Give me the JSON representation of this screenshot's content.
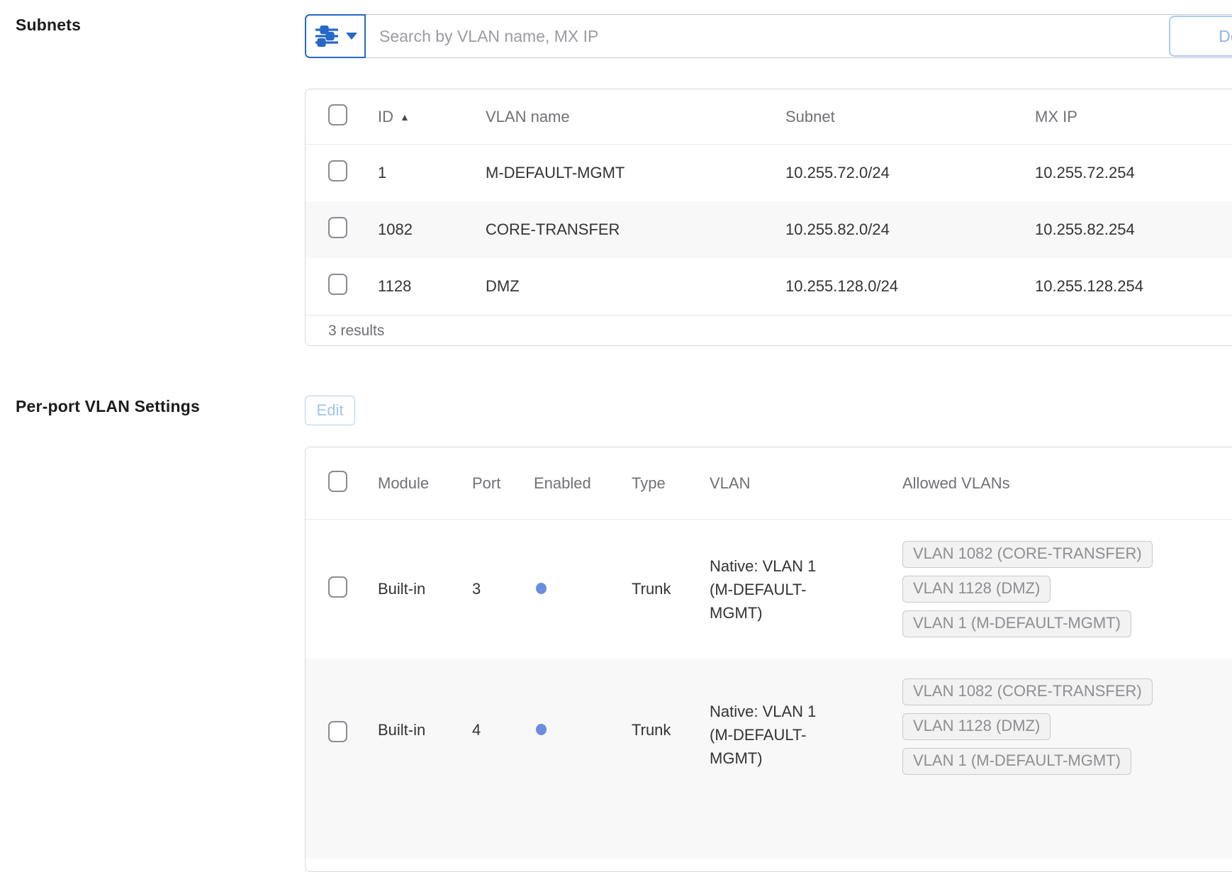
{
  "colors": {
    "accent_blue": "#2569c8",
    "enabled_dot_blue": "#6a8ddf",
    "disabled_button_blue": "#8fb4ea",
    "tag_text_gray": "#8e8e93",
    "header_text_gray": "#717175"
  },
  "subnets": {
    "label": "Subnets",
    "toolbar": {
      "filter_icon": "sliders-icon",
      "search_placeholder": "Search by VLAN name, MX IP",
      "search_value": "",
      "delete_label": "De"
    },
    "table": {
      "columns": [
        "ID",
        "VLAN name",
        "Subnet",
        "MX IP"
      ],
      "sort": {
        "column": "ID",
        "direction": "ascending",
        "glyph": "▲"
      },
      "rows": [
        {
          "id": "1",
          "vlan_name": "M-DEFAULT-MGMT",
          "subnet": "10.255.72.0/24",
          "mx_ip": "10.255.72.254"
        },
        {
          "id": "1082",
          "vlan_name": "CORE-TRANSFER",
          "subnet": "10.255.82.0/24",
          "mx_ip": "10.255.82.254"
        },
        {
          "id": "1128",
          "vlan_name": "DMZ",
          "subnet": "10.255.128.0/24",
          "mx_ip": "10.255.128.254"
        }
      ],
      "results_text": "3 results"
    }
  },
  "perport": {
    "label": "Per-port VLAN Settings",
    "edit_label": "Edit",
    "table": {
      "columns": [
        "Module",
        "Port",
        "Enabled",
        "Type",
        "VLAN",
        "Allowed VLANs"
      ],
      "rows": [
        {
          "module": "Built-in",
          "port": "3",
          "enabled": true,
          "type": "Trunk",
          "vlan": "Native: VLAN 1 (M-DEFAULT-MGMT)",
          "allowed_vlans": [
            "VLAN 1082 (CORE-TRANSFER)",
            "VLAN 1128 (DMZ)",
            "VLAN 1 (M-DEFAULT-MGMT)"
          ]
        },
        {
          "module": "Built-in",
          "port": "4",
          "enabled": true,
          "type": "Trunk",
          "vlan": "Native: VLAN 1 (M-DEFAULT-MGMT)",
          "allowed_vlans": [
            "VLAN 1082 (CORE-TRANSFER)",
            "VLAN 1128 (DMZ)",
            "VLAN 1 (M-DEFAULT-MGMT)"
          ]
        }
      ]
    }
  }
}
